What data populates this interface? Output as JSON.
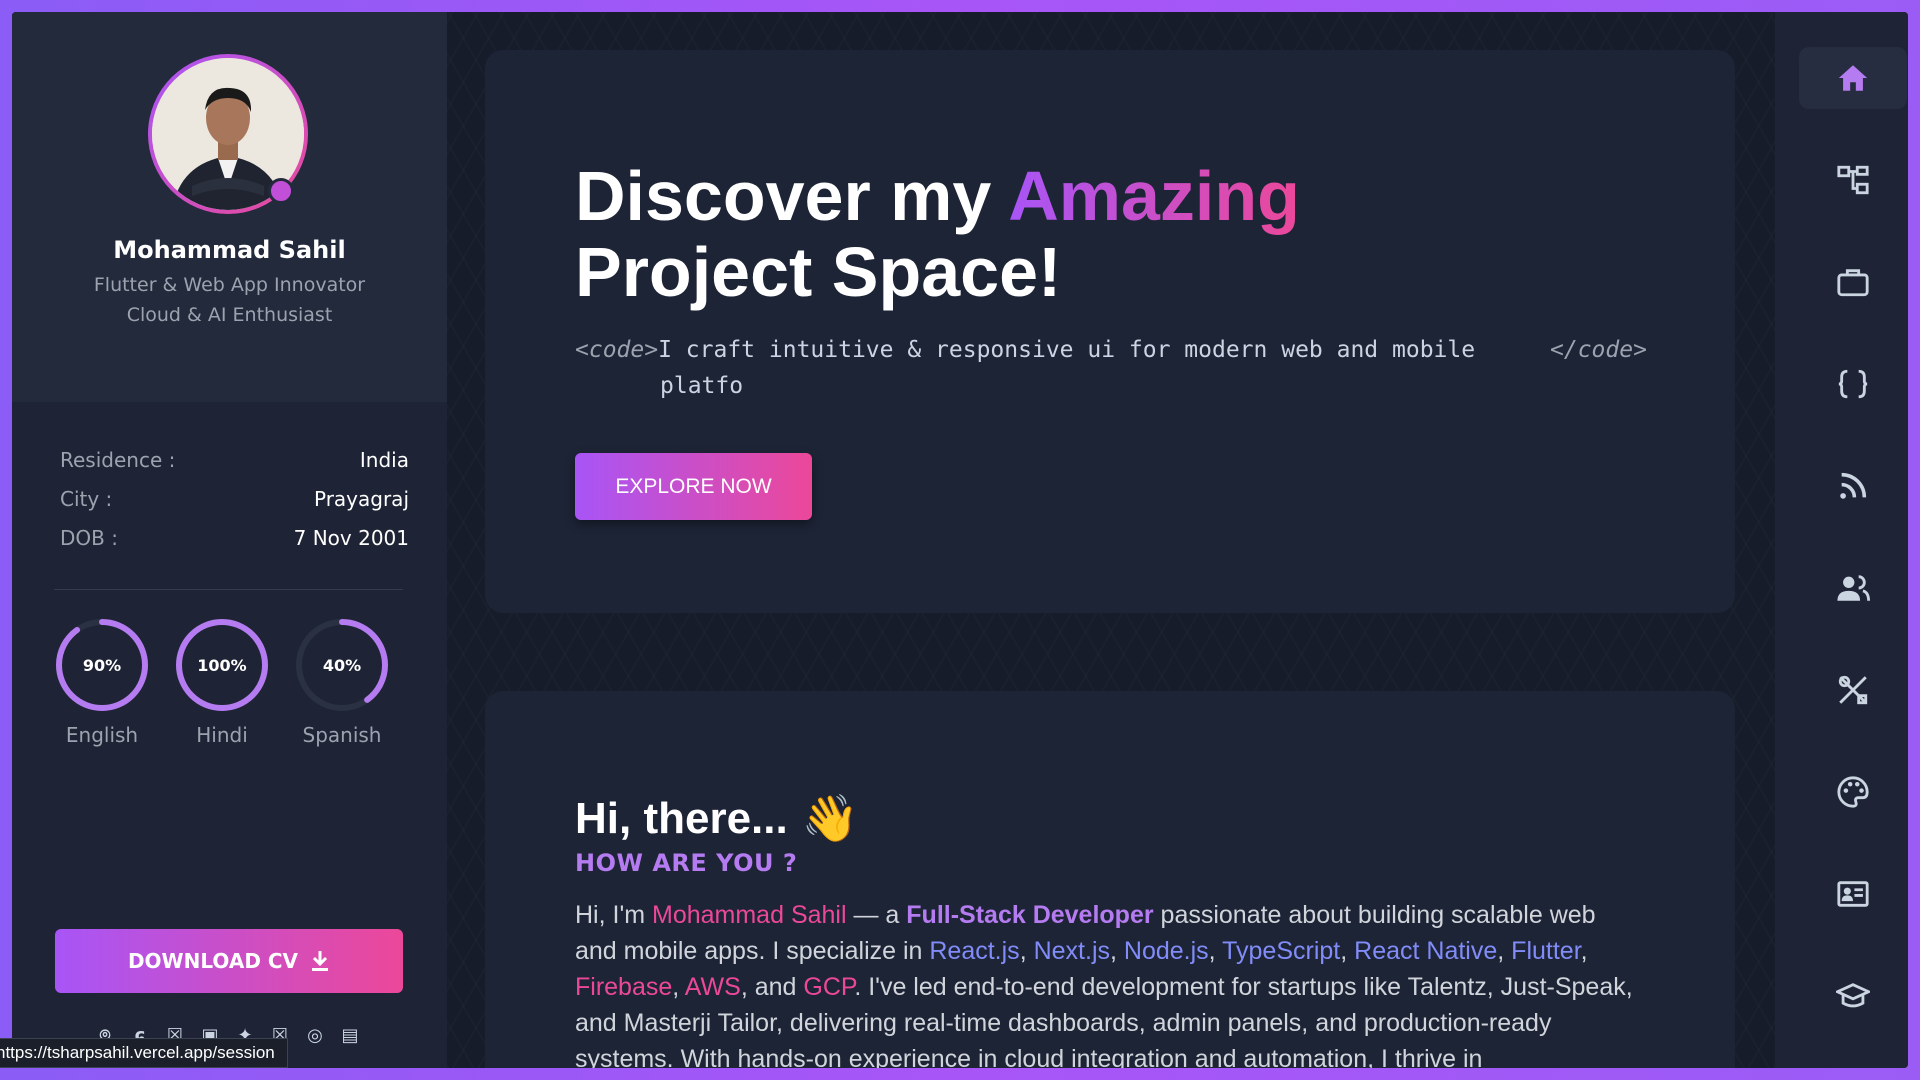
{
  "profile": {
    "name": "Mohammad Sahil",
    "tagline_1": "Flutter & Web App Innovator",
    "tagline_2": "Cloud & AI Enthusiast"
  },
  "info": [
    {
      "label": "Residence :",
      "value": "India"
    },
    {
      "label": "City :",
      "value": "Prayagraj"
    },
    {
      "label": "DOB :",
      "value": "7 Nov 2001"
    }
  ],
  "languages": [
    {
      "name": "English",
      "percent_label": "90%",
      "percent": 90
    },
    {
      "name": "Hindi",
      "percent_label": "100%",
      "percent": 100
    },
    {
      "name": "Spanish",
      "percent_label": "40%",
      "percent": 40
    }
  ],
  "download_label": "DOWNLOAD CV",
  "socials": [
    "github-icon",
    "gitlab-icon",
    "x-icon",
    "linkedin-icon",
    "twitter-icon",
    "x-icon",
    "instagram-icon",
    "facebook-icon"
  ],
  "status_url": "https://tsharpsahil.vercel.app/session",
  "hero": {
    "title_1": "Discover my ",
    "title_highlight": "Amazing",
    "title_2": "Project Space!",
    "code_open": "<code>",
    "code_text_1": "I craft intuitive & responsive ui for modern web and mobile",
    "code_close": "</code>",
    "code_text_2": "platfo",
    "button": "EXPLORE NOW"
  },
  "about": {
    "greeting": "Hi, there...",
    "wave": "👋",
    "subtitle": "HOW ARE YOU ?",
    "bio": {
      "p1": "Hi, I'm ",
      "name": "Mohammad Sahil",
      "p2": " — a ",
      "role": "Full-Stack Developer",
      "p3": " passionate about building scalable web and mobile apps. I specialize in ",
      "t1": "React.js",
      "c1": ", ",
      "t2": "Next.js",
      "c2": ", ",
      "t3": "Node.js",
      "c3": ", ",
      "t4": "TypeScript",
      "c4": ", ",
      "t5": "React Native",
      "c5": ", ",
      "t6": "Flutter",
      "c6": ", ",
      "t7": "Firebase",
      "c7": ", ",
      "t8": "AWS",
      "c8": ", and ",
      "t9": "GCP",
      "p4": ". I've led end-to-end development for startups like Talentz, Just-Speak, and Masterji Tailor, delivering real-time dashboards, admin panels, and production-ready systems. With hands-on experience in cloud integration and automation, I thrive in"
    }
  },
  "nav": [
    "home-icon",
    "sitemap-icon",
    "briefcase-icon",
    "code-braces-icon",
    "rss-icon",
    "users-icon",
    "tools-icon",
    "palette-icon",
    "contact-card-icon",
    "graduation-cap-icon"
  ],
  "colors": {
    "accent_purple": "#a855f7",
    "accent_pink": "#ec4899",
    "bg": "#1b2131"
  }
}
